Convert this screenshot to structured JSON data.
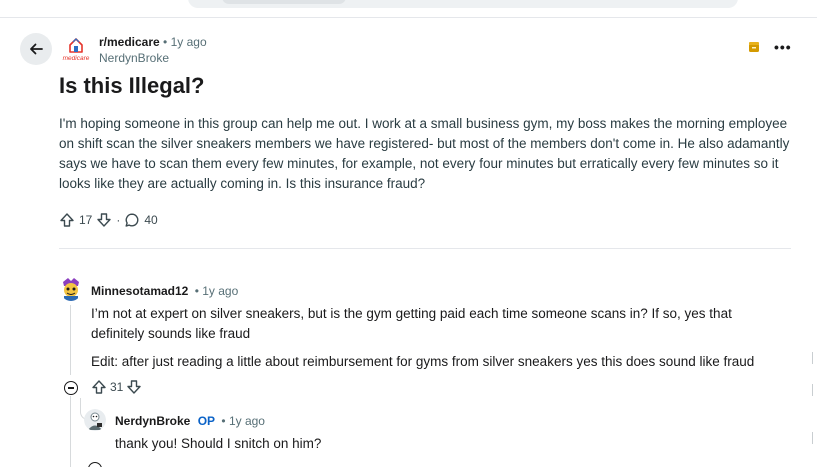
{
  "header": {
    "subreddit": "r/medicare",
    "post_age": "1y ago",
    "author": "NerdynBroke",
    "community_logo_text": "medicare",
    "more_label": "•••"
  },
  "post": {
    "title": "Is this Illegal?",
    "body": "I'm hoping someone in this group can help me out. I work at a small business gym, my boss makes the morning employee on shift scan the silver sneakers members we have registered- but most of the members don't come in. He also adamantly says we have to scan them every few minutes, for example, not every four minutes but erratically every few minutes so it looks like they are actually coming in. Is this insurance fraud?",
    "upvotes": "17",
    "comments_count": "40",
    "separator": "·"
  },
  "comments": [
    {
      "author": "Minnesotamad12",
      "age": "1y ago",
      "paragraphs": [
        "I’m not at expert on silver sneakers, but is the gym getting paid each time someone scans in? If so, yes that definitely sounds like fraud",
        "Edit: after just reading a little about reimbursement for gyms from silver sneakers yes this does sound like fraud"
      ],
      "score": "31"
    },
    {
      "author": "NerdynBroke",
      "flair": "OP",
      "age": "1y ago",
      "paragraphs": [
        "thank you! Should I snitch on him?"
      ]
    }
  ],
  "colors": {
    "accent_op": "#0a62c7",
    "muted": "#576f76",
    "award_icon": "#d49a00"
  }
}
